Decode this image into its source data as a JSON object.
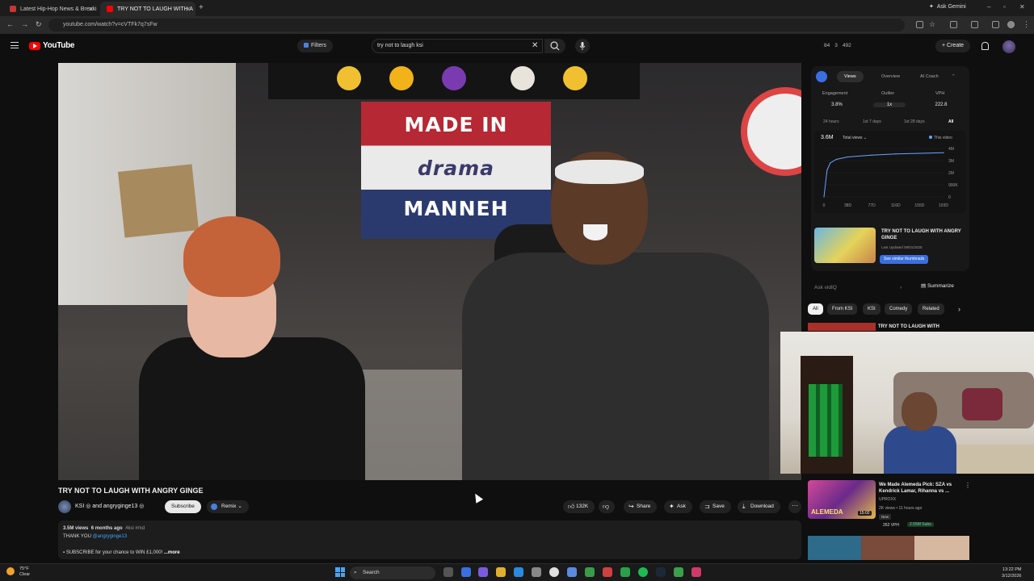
{
  "browser": {
    "tabs": [
      {
        "title": "Latest Hip-Hop News & Breaki"
      },
      {
        "title": "TRY NOT TO LAUGH WITH A"
      }
    ],
    "url": "youtube.com/watch?v=cVTFk7q7sFw",
    "ask_gemini": "Ask Gemini"
  },
  "header": {
    "logo": "YouTube",
    "filters": "Filters",
    "search_value": "try not to laugh ksi",
    "stats": [
      "84",
      "3",
      "492"
    ],
    "create": "Create"
  },
  "video": {
    "flag_lines": [
      "MADE IN",
      "drama",
      "MANNEH"
    ],
    "title": "TRY NOT TO LAUGH WITH ANGRY GINGE",
    "channel": "KSI",
    "channel_line": "KSI ◎ and angryginge13 ◎",
    "subscribe": "Subscribe",
    "remix": "Remix",
    "likes": "132K",
    "share": "Share",
    "ask": "Ask",
    "save": "Save",
    "download": "Download",
    "description": {
      "views": "3.5M views",
      "age": "6 months ago",
      "tags": "#ksi #md",
      "line2_prefix": "THANK YOU",
      "line2_link": "@angryginge13",
      "line3": "SUBSCRIBE for your chance to WIN £1,000!",
      "more": "...more"
    }
  },
  "vidiq": {
    "tabs": [
      "Views",
      "Overview",
      "AI Coach"
    ],
    "metrics": [
      {
        "label": "Engagement",
        "value": "3.8%"
      },
      {
        "label": "Outlier",
        "value": "1x"
      },
      {
        "label": "VPH",
        "value": "222.8"
      }
    ],
    "ranges": [
      "24 hours",
      "1st 7 days",
      "1st 28 days",
      "All"
    ],
    "total_views": "3.6M",
    "total_label": "Total views",
    "legend": "This video",
    "thumb_title": "TRY NOT TO LAUGH WITH ANGRY GINGE",
    "last_updated": "Last Updated 09/01/2025",
    "see_similar": "See similar thumbnails",
    "ask_placeholder": "Ask vidIQ",
    "summarize": "Summarize"
  },
  "chart_data": {
    "type": "line",
    "x": [
      0,
      5,
      10,
      20,
      38,
      77,
      116,
      155,
      193
    ],
    "values": [
      0,
      2.2,
      2.8,
      3.1,
      3.3,
      3.45,
      3.55,
      3.6,
      3.65
    ],
    "xlabel": "",
    "ylabel": "",
    "x_ticks": [
      "0",
      "38D",
      "77D",
      "116D",
      "155D",
      "193D"
    ],
    "y_ticks": [
      "4M",
      "3M",
      "2M",
      "900K",
      "0"
    ],
    "ylim": [
      0,
      4
    ],
    "series_name": "This video",
    "color": "#6da3ff"
  },
  "chips": [
    "All",
    "From KSI",
    "KSI",
    "Comedy",
    "Related"
  ],
  "recommendations": [
    {
      "title": "TRY NOT TO LAUGH WITH"
    },
    {
      "title": "We Made Alemeda Pick: SZA vs Kendrick Lamar, Rihanna vs ...",
      "thumb_text": "ALEMEDA",
      "duration": "15:02",
      "channel": "UPROXX",
      "meta": "2K views • 11 hours ago",
      "badge": "New",
      "vph": "262 VPH",
      "subs": "2.55M Subs"
    }
  ],
  "taskbar": {
    "temp": "75°F",
    "weather": "Clear",
    "search": "Search",
    "time": "13:22 PM",
    "date": "3/12/2026"
  }
}
